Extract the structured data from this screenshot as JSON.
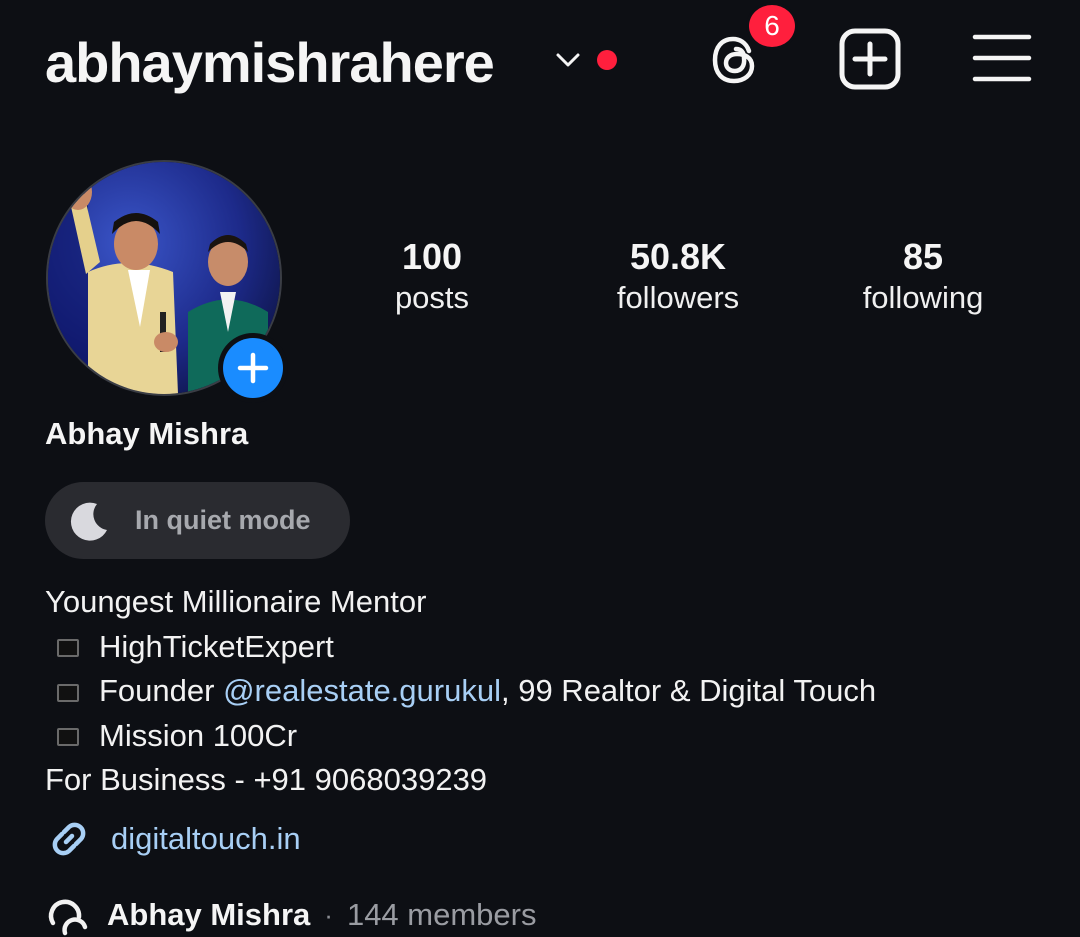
{
  "header": {
    "username": "abhaymishrahere",
    "threads_badge": "6"
  },
  "profile": {
    "stats": [
      {
        "value": "100",
        "label": "posts"
      },
      {
        "value": "50.8K",
        "label": "followers"
      },
      {
        "value": "85",
        "label": "following"
      }
    ],
    "full_name": "Abhay Mishra",
    "status": "In quiet mode"
  },
  "bio": {
    "line1": "Youngest Millionaire Mentor",
    "line2": "HighTicketExpert",
    "line3_prefix": "Founder ",
    "line3_mention": "@realestate.gurukul",
    "line3_suffix": ", 99 Realtor & Digital Touch",
    "line4": "Mission 100Cr",
    "line5": "For Business - +91 9068039239"
  },
  "link": {
    "text": "digitaltouch.in"
  },
  "channel": {
    "name": "Abhay Mishra",
    "separator": "·",
    "members": "144 members"
  },
  "colors": {
    "background": "#0d0f14",
    "accent_blue": "#1a8cff",
    "link": "#a8cff5",
    "notification_red": "#ff1f3d"
  },
  "icons": [
    "chevron-down-icon",
    "threads-icon",
    "new-post-icon",
    "menu-icon",
    "add-story-icon",
    "moon-icon",
    "link-icon",
    "broadcast-channel-icon"
  ]
}
